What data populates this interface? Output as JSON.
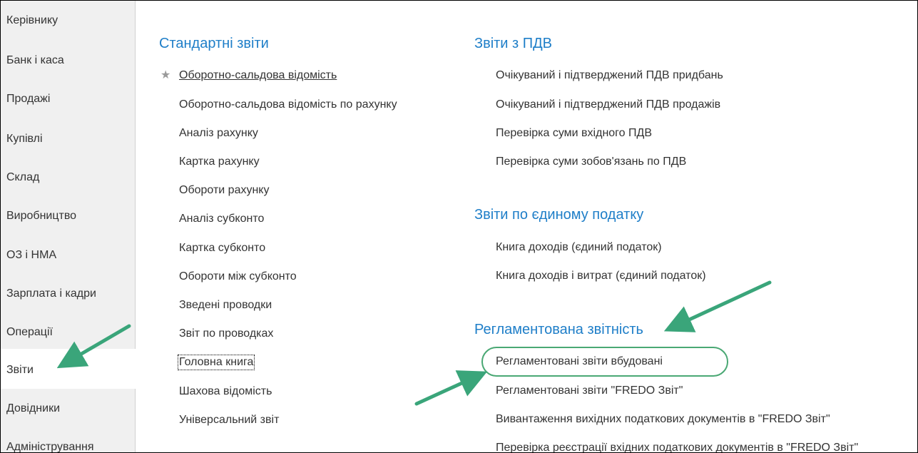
{
  "sidebar": {
    "items": [
      {
        "label": "Керівнику"
      },
      {
        "label": "Банк і каса"
      },
      {
        "label": "Продажі"
      },
      {
        "label": "Купівлі"
      },
      {
        "label": "Склад"
      },
      {
        "label": "Виробництво"
      },
      {
        "label": "ОЗ і НМА"
      },
      {
        "label": "Зарплата і кадри"
      },
      {
        "label": "Операції"
      },
      {
        "label": "Звіти"
      },
      {
        "label": "Довідники"
      },
      {
        "label": "Адміністрування"
      }
    ],
    "active_index": 9
  },
  "standard_reports": {
    "title": "Стандартні звіти",
    "items": [
      "Оборотно-сальдова відомість",
      "Оборотно-сальдова відомість по рахунку",
      "Аналіз рахунку",
      "Картка рахунку",
      "Обороти рахунку",
      "Аналіз субконто",
      "Картка субконто",
      "Обороти між субконто",
      "Зведені проводки",
      "Звіт по проводках",
      "Головна книга",
      "Шахова відомість",
      "Універсальний звіт"
    ]
  },
  "vat_reports": {
    "title": "Звіти з ПДВ",
    "items": [
      "Очікуваний і підтверджений ПДВ придбань",
      "Очікуваний і підтверджений ПДВ продажів",
      "Перевірка суми вхідного ПДВ",
      "Перевірка суми зобов'язань по ПДВ"
    ]
  },
  "single_tax_reports": {
    "title": "Звіти по єдиному податку",
    "items": [
      "Книга доходів (єдиний податок)",
      "Книга доходів і витрат (єдиний податок)"
    ]
  },
  "regulated_reports": {
    "title": "Регламентована звітність",
    "items": [
      "Регламентовані звіти вбудовані",
      "Регламентовані звіти \"FREDO Звіт\"",
      "Вивантаження вихідних податкових документів в \"FREDO Звіт\"",
      "Перевірка реєстрації вхідних податкових документів в \"FREDO Звіт\""
    ]
  },
  "colors": {
    "section_title": "#1e7ec8",
    "annotation_arrow": "#3aa57a",
    "sidebar_bg": "#f0f0f0"
  },
  "icons": {
    "favorite": "star-icon"
  }
}
